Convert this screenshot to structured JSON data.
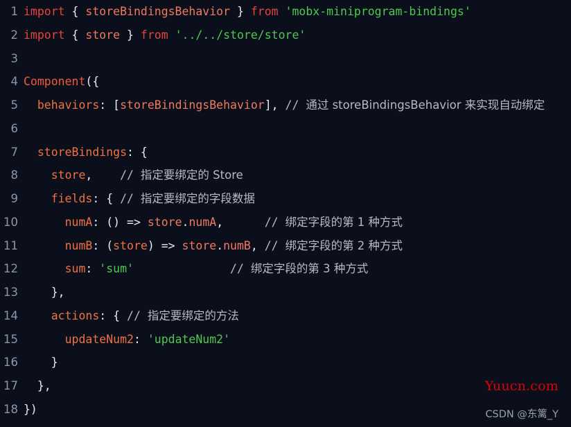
{
  "editor": {
    "background_color": "#0b0f1c",
    "line_number_color": "#8f96a8",
    "gutter_numbers": [
      "1",
      "2",
      "3",
      "4",
      "5",
      "6",
      "7",
      "8",
      "9",
      "10",
      "11",
      "12",
      "13",
      "14",
      "15",
      "16",
      "17",
      "18"
    ],
    "colors": {
      "keyword": "#e8433c",
      "function": "#f05a36",
      "identifier": "#f0795e",
      "object_key": "#f0713f",
      "string": "#4ec94e",
      "punctuation": "#e9ebf1",
      "comment": "#b6bac4"
    },
    "lines": [
      {
        "number": "1",
        "tokens": [
          {
            "cls": "t-kw",
            "text": "import"
          },
          {
            "cls": "t-punc",
            "text": " { "
          },
          {
            "cls": "t-ident",
            "text": "storeBindingsBehavior"
          },
          {
            "cls": "t-punc",
            "text": " } "
          },
          {
            "cls": "t-kw",
            "text": "from"
          },
          {
            "cls": "t-punc",
            "text": " "
          },
          {
            "cls": "t-str",
            "text": "'mobx-miniprogram-bindings'"
          }
        ]
      },
      {
        "number": "2",
        "tokens": [
          {
            "cls": "t-kw",
            "text": "import"
          },
          {
            "cls": "t-punc",
            "text": " { "
          },
          {
            "cls": "t-ident",
            "text": "store"
          },
          {
            "cls": "t-punc",
            "text": " } "
          },
          {
            "cls": "t-kw",
            "text": "from"
          },
          {
            "cls": "t-punc",
            "text": " "
          },
          {
            "cls": "t-str",
            "text": "'../../store/store'"
          }
        ]
      },
      {
        "number": "3",
        "tokens": []
      },
      {
        "number": "4",
        "tokens": [
          {
            "cls": "t-fn",
            "text": "Component"
          },
          {
            "cls": "t-punc",
            "text": "({"
          }
        ]
      },
      {
        "number": "5",
        "tokens": [
          {
            "cls": "t-punc",
            "text": "  "
          },
          {
            "cls": "t-key",
            "text": "behaviors"
          },
          {
            "cls": "t-punc",
            "text": ": ["
          },
          {
            "cls": "t-ident",
            "text": "storeBindingsBehavior"
          },
          {
            "cls": "t-punc",
            "text": "], "
          },
          {
            "cls": "t-comment",
            "text": "// "
          },
          {
            "cls": "t-comment-cn",
            "text": "通过 storeBindingsBehavior 来实现自动绑定"
          }
        ]
      },
      {
        "number": "6",
        "tokens": []
      },
      {
        "number": "7",
        "tokens": [
          {
            "cls": "t-punc",
            "text": "  "
          },
          {
            "cls": "t-key",
            "text": "storeBindings"
          },
          {
            "cls": "t-punc",
            "text": ": {"
          }
        ]
      },
      {
        "number": "8",
        "tokens": [
          {
            "cls": "t-punc",
            "text": "    "
          },
          {
            "cls": "t-key",
            "text": "store"
          },
          {
            "cls": "t-punc",
            "text": ",    "
          },
          {
            "cls": "t-comment",
            "text": "// "
          },
          {
            "cls": "t-comment-cn",
            "text": "指定要绑定的 Store"
          }
        ]
      },
      {
        "number": "9",
        "tokens": [
          {
            "cls": "t-punc",
            "text": "    "
          },
          {
            "cls": "t-key",
            "text": "fields"
          },
          {
            "cls": "t-punc",
            "text": ": { "
          },
          {
            "cls": "t-comment",
            "text": "// "
          },
          {
            "cls": "t-comment-cn",
            "text": "指定要绑定的字段数据"
          }
        ]
      },
      {
        "number": "10",
        "tokens": [
          {
            "cls": "t-punc",
            "text": "      "
          },
          {
            "cls": "t-key",
            "text": "numA"
          },
          {
            "cls": "t-punc",
            "text": ": () => "
          },
          {
            "cls": "t-ident",
            "text": "store"
          },
          {
            "cls": "t-punc",
            "text": "."
          },
          {
            "cls": "t-ident",
            "text": "numA"
          },
          {
            "cls": "t-punc",
            "text": ",      "
          },
          {
            "cls": "t-comment",
            "text": "// "
          },
          {
            "cls": "t-comment-cn",
            "text": "绑定字段的第 1 种方式"
          }
        ]
      },
      {
        "number": "11",
        "tokens": [
          {
            "cls": "t-punc",
            "text": "      "
          },
          {
            "cls": "t-key",
            "text": "numB"
          },
          {
            "cls": "t-punc",
            "text": ": ("
          },
          {
            "cls": "t-param",
            "text": "store"
          },
          {
            "cls": "t-punc",
            "text": ") => "
          },
          {
            "cls": "t-ident",
            "text": "store"
          },
          {
            "cls": "t-punc",
            "text": "."
          },
          {
            "cls": "t-ident",
            "text": "numB"
          },
          {
            "cls": "t-punc",
            "text": ", "
          },
          {
            "cls": "t-comment",
            "text": "// "
          },
          {
            "cls": "t-comment-cn",
            "text": "绑定字段的第 2 种方式"
          }
        ]
      },
      {
        "number": "12",
        "tokens": [
          {
            "cls": "t-punc",
            "text": "      "
          },
          {
            "cls": "t-key",
            "text": "sum"
          },
          {
            "cls": "t-punc",
            "text": ": "
          },
          {
            "cls": "t-str",
            "text": "'sum'"
          },
          {
            "cls": "t-punc",
            "text": "              "
          },
          {
            "cls": "t-comment",
            "text": "// "
          },
          {
            "cls": "t-comment-cn",
            "text": "绑定字段的第 3 种方式"
          }
        ]
      },
      {
        "number": "13",
        "tokens": [
          {
            "cls": "t-punc",
            "text": "    },"
          }
        ]
      },
      {
        "number": "14",
        "tokens": [
          {
            "cls": "t-punc",
            "text": "    "
          },
          {
            "cls": "t-key",
            "text": "actions"
          },
          {
            "cls": "t-punc",
            "text": ": { "
          },
          {
            "cls": "t-comment",
            "text": "// "
          },
          {
            "cls": "t-comment-cn",
            "text": "指定要绑定的方法"
          }
        ]
      },
      {
        "number": "15",
        "tokens": [
          {
            "cls": "t-punc",
            "text": "      "
          },
          {
            "cls": "t-key",
            "text": "updateNum2"
          },
          {
            "cls": "t-punc",
            "text": ": "
          },
          {
            "cls": "t-str",
            "text": "'updateNum2'"
          }
        ]
      },
      {
        "number": "16",
        "tokens": [
          {
            "cls": "t-punc",
            "text": "    }"
          }
        ]
      },
      {
        "number": "17",
        "tokens": [
          {
            "cls": "t-punc",
            "text": "  },"
          }
        ]
      },
      {
        "number": "18",
        "tokens": [
          {
            "cls": "t-punc",
            "text": "})"
          }
        ]
      }
    ]
  },
  "watermarks": {
    "site": "Yuucn.com",
    "site_color": "#e00000",
    "csdn": "CSDN @东篱_Y",
    "csdn_color": "#9aa0ac"
  }
}
